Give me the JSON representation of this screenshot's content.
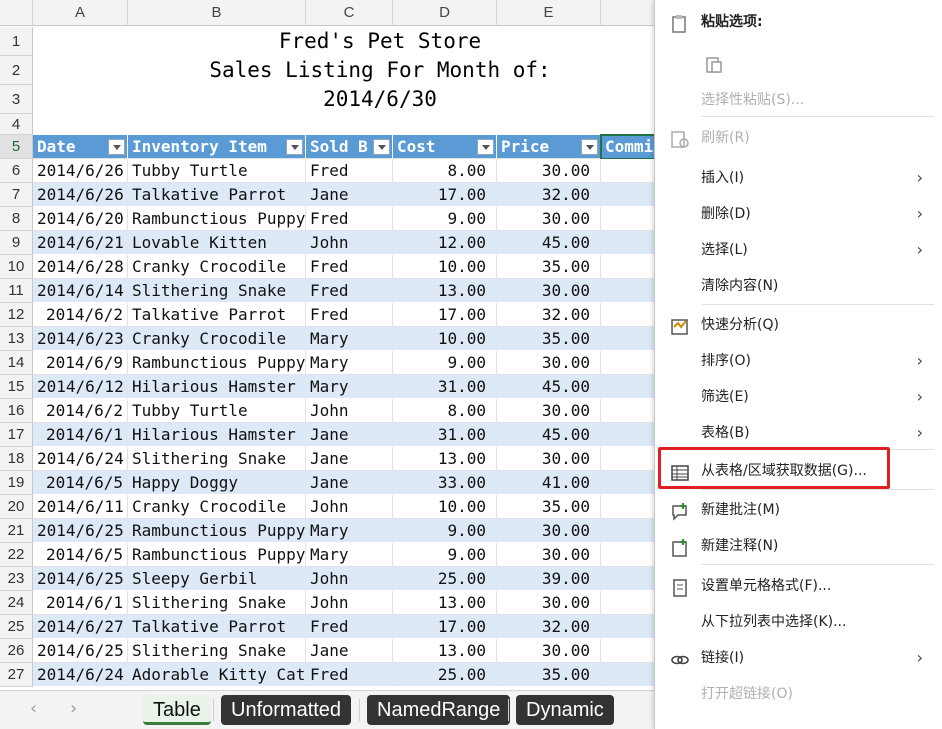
{
  "columns": [
    "A",
    "B",
    "C",
    "D",
    "E"
  ],
  "title_lines": [
    "Fred's Pet Store",
    "Sales Listing For Month of:",
    "2014/6/30"
  ],
  "row_numbers": [
    "1",
    "2",
    "3",
    "4",
    "5",
    "6",
    "7",
    "8",
    "9",
    "10",
    "11",
    "12",
    "13",
    "14",
    "15",
    "16",
    "17",
    "18",
    "19",
    "20",
    "21",
    "22",
    "23",
    "24",
    "25",
    "26",
    "27"
  ],
  "table": {
    "headers": [
      "Date",
      "Inventory Item",
      "Sold B",
      "Cost",
      "Price",
      "Commi"
    ],
    "rows": [
      [
        "2014/6/26",
        "Tubby Turtle",
        "Fred",
        "8.00",
        "30.00"
      ],
      [
        "2014/6/26",
        "Talkative Parrot",
        "Jane",
        "17.00",
        "32.00"
      ],
      [
        "2014/6/20",
        "Rambunctious Puppy",
        "Fred",
        "9.00",
        "30.00"
      ],
      [
        "2014/6/21",
        "Lovable Kitten",
        "John",
        "12.00",
        "45.00"
      ],
      [
        "2014/6/28",
        "Cranky Crocodile",
        "Fred",
        "10.00",
        "35.00"
      ],
      [
        "2014/6/14",
        "Slithering Snake",
        "Fred",
        "13.00",
        "30.00"
      ],
      [
        "2014/6/2",
        "Talkative Parrot",
        "Fred",
        "17.00",
        "32.00"
      ],
      [
        "2014/6/23",
        "Cranky Crocodile",
        "Mary",
        "10.00",
        "35.00"
      ],
      [
        "2014/6/9",
        "Rambunctious Puppy",
        "Mary",
        "9.00",
        "30.00"
      ],
      [
        "2014/6/12",
        "Hilarious Hamster",
        "Mary",
        "31.00",
        "45.00"
      ],
      [
        "2014/6/2",
        "Tubby Turtle",
        "John",
        "8.00",
        "30.00"
      ],
      [
        "2014/6/1",
        "Hilarious Hamster",
        "Jane",
        "31.00",
        "45.00"
      ],
      [
        "2014/6/24",
        "Slithering Snake",
        "Jane",
        "13.00",
        "30.00"
      ],
      [
        "2014/6/5",
        "Happy Doggy",
        "Jane",
        "33.00",
        "41.00"
      ],
      [
        "2014/6/11",
        "Cranky Crocodile",
        "John",
        "10.00",
        "35.00"
      ],
      [
        "2014/6/25",
        "Rambunctious Puppy",
        "Mary",
        "9.00",
        "30.00"
      ],
      [
        "2014/6/5",
        "Rambunctious Puppy",
        "Mary",
        "9.00",
        "30.00"
      ],
      [
        "2014/6/25",
        "Sleepy Gerbil",
        "John",
        "25.00",
        "39.00"
      ],
      [
        "2014/6/1",
        "Slithering Snake",
        "John",
        "13.00",
        "30.00"
      ],
      [
        "2014/6/27",
        "Talkative Parrot",
        "Fred",
        "17.00",
        "32.00"
      ],
      [
        "2014/6/25",
        "Slithering Snake",
        "Jane",
        "13.00",
        "30.00"
      ],
      [
        "2014/6/24",
        "Adorable Kitty Cat",
        "Fred",
        "25.00",
        "35.00"
      ]
    ]
  },
  "sheet_tabs": [
    "Table",
    "Unformatted",
    "NamedRange",
    "Dynamic"
  ],
  "context_menu": {
    "items": [
      {
        "label": "粘贴选项:",
        "icon": "clipboard-icon",
        "disabled": false,
        "bold": true
      },
      {
        "label": "",
        "icon": "paste-icon",
        "disabled": false
      },
      {
        "label": "选择性粘贴(S)...",
        "icon": "",
        "disabled": true
      },
      {
        "label": "刷新(R)",
        "icon": "refresh-icon",
        "disabled": true
      },
      {
        "label": "插入(I)",
        "icon": "",
        "disabled": false,
        "submenu": true
      },
      {
        "label": "删除(D)",
        "icon": "",
        "disabled": false,
        "submenu": true
      },
      {
        "label": "选择(L)",
        "icon": "",
        "disabled": false,
        "submenu": true
      },
      {
        "label": "清除内容(N)",
        "icon": "",
        "disabled": false
      },
      {
        "label": "快速分析(Q)",
        "icon": "quick-analysis-icon",
        "disabled": false
      },
      {
        "label": "排序(O)",
        "icon": "",
        "disabled": false,
        "submenu": true
      },
      {
        "label": "筛选(E)",
        "icon": "",
        "disabled": false,
        "submenu": true
      },
      {
        "label": "表格(B)",
        "icon": "",
        "disabled": false,
        "submenu": true
      },
      {
        "label": "从表格/区域获取数据(G)...",
        "icon": "table-icon",
        "disabled": false,
        "highlighted": true
      },
      {
        "label": "新建批注(M)",
        "icon": "new-comment-icon",
        "disabled": false
      },
      {
        "label": "新建注释(N)",
        "icon": "new-note-icon",
        "disabled": false
      },
      {
        "label": "设置单元格格式(F)...",
        "icon": "format-cells-icon",
        "disabled": false
      },
      {
        "label": "从下拉列表中选择(K)...",
        "icon": "",
        "disabled": false
      },
      {
        "label": "链接(I)",
        "icon": "link-icon",
        "disabled": false,
        "submenu": true
      },
      {
        "label": "打开超链接(O)",
        "icon": "",
        "disabled": true
      }
    ]
  },
  "colors": {
    "accent": "#217346",
    "table_header": "#5b9bd5",
    "band": "#dde9f6",
    "highlight_box": "#e02020"
  }
}
